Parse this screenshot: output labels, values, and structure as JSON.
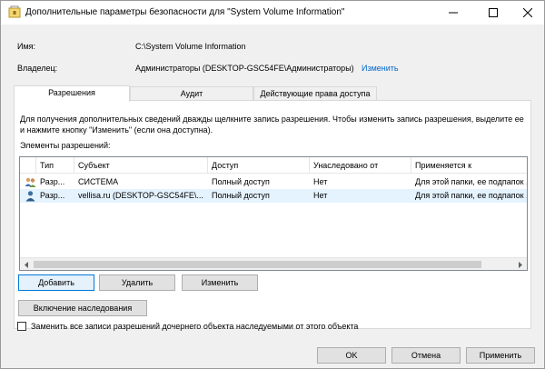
{
  "window": {
    "title": "Дополнительные параметры безопасности  для \"System Volume Information\""
  },
  "info": {
    "name_label": "Имя:",
    "name_value": "C:\\System Volume Information",
    "owner_label": "Владелец:",
    "owner_value": "Администраторы (DESKTOP-GSC54FE\\Администраторы)",
    "owner_change_link": "Изменить"
  },
  "tabs": [
    {
      "label": "Разрешения",
      "active": true
    },
    {
      "label": "Аудит",
      "active": false
    },
    {
      "label": "Действующие права доступа",
      "active": false
    }
  ],
  "permissions": {
    "description": "Для получения дополнительных сведений дважды щелкните запись разрешения. Чтобы изменить запись разрешения, выделите ее и нажмите кнопку \"Изменить\" (если она доступна).",
    "entries_label": "Элементы разрешений:",
    "columns": [
      "Тип",
      "Субъект",
      "Доступ",
      "Унаследовано от",
      "Применяется к"
    ],
    "rows": [
      {
        "type": "Разр...",
        "subject": "СИСТЕМА",
        "access": "Полный доступ",
        "inherited": "Нет",
        "applies": "Для этой папки, ее подпапок ...",
        "icon": "user-group-icon",
        "selected": false
      },
      {
        "type": "Разр...",
        "subject": "vellisa.ru (DESKTOP-GSC54FE\\...",
        "access": "Полный доступ",
        "inherited": "Нет",
        "applies": "Для этой папки, ее подпапок ...",
        "icon": "user-icon",
        "selected": true
      }
    ]
  },
  "buttons": {
    "add": "Добавить",
    "remove": "Удалить",
    "edit": "Изменить",
    "enable_inheritance": "Включение наследования",
    "ok": "OK",
    "cancel": "Отмена",
    "apply": "Применить"
  },
  "replace_checkbox": {
    "label": "Заменить все записи разрешений дочернего объекта наследуемыми от этого объекта",
    "checked": false
  },
  "colors": {
    "link": "#0066cc",
    "selection": "#e5f3ff",
    "focus_border": "#0078d7"
  }
}
